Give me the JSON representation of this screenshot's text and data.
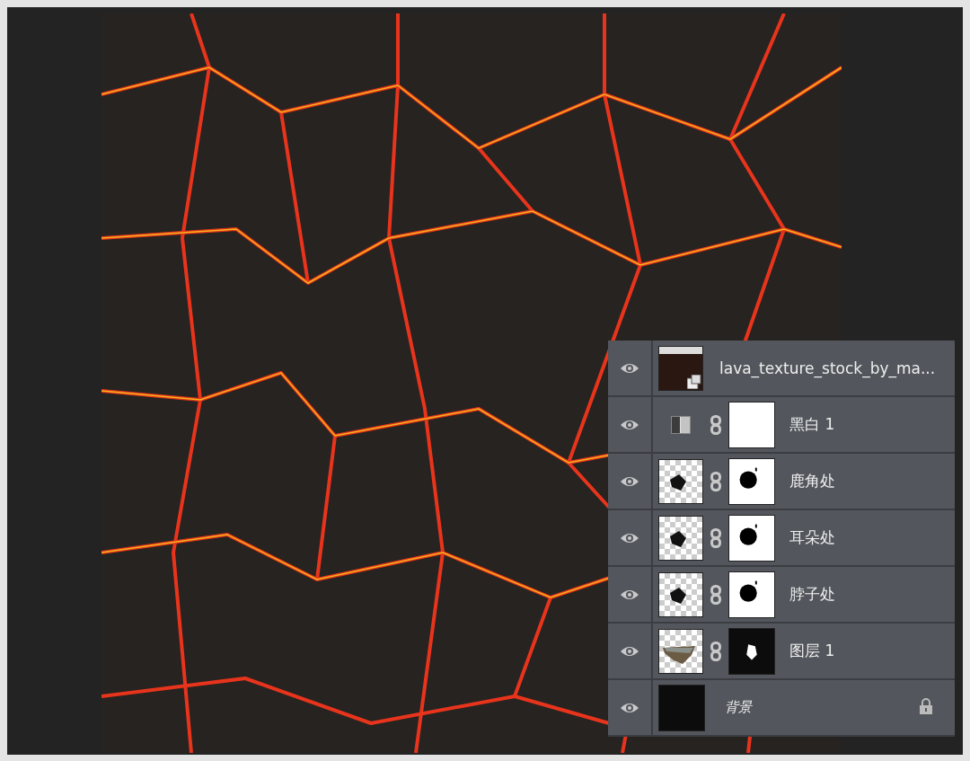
{
  "layers_panel": {
    "layers": [
      {
        "name": "lava_texture_stock_by_ma...",
        "kind": "smart_object",
        "visible": true,
        "locked": false
      },
      {
        "name": "黑白 1",
        "kind": "adjustment",
        "visible": true,
        "locked": false
      },
      {
        "name": "鹿角处",
        "kind": "masked_shape",
        "visible": true,
        "locked": false
      },
      {
        "name": "耳朵处",
        "kind": "masked_shape",
        "visible": true,
        "locked": false
      },
      {
        "name": "脖子处",
        "kind": "masked_shape",
        "visible": true,
        "locked": false
      },
      {
        "name": "图层 1",
        "kind": "masked_photo",
        "visible": true,
        "locked": false
      },
      {
        "name": "背景",
        "kind": "background",
        "visible": true,
        "locked": true
      }
    ]
  }
}
